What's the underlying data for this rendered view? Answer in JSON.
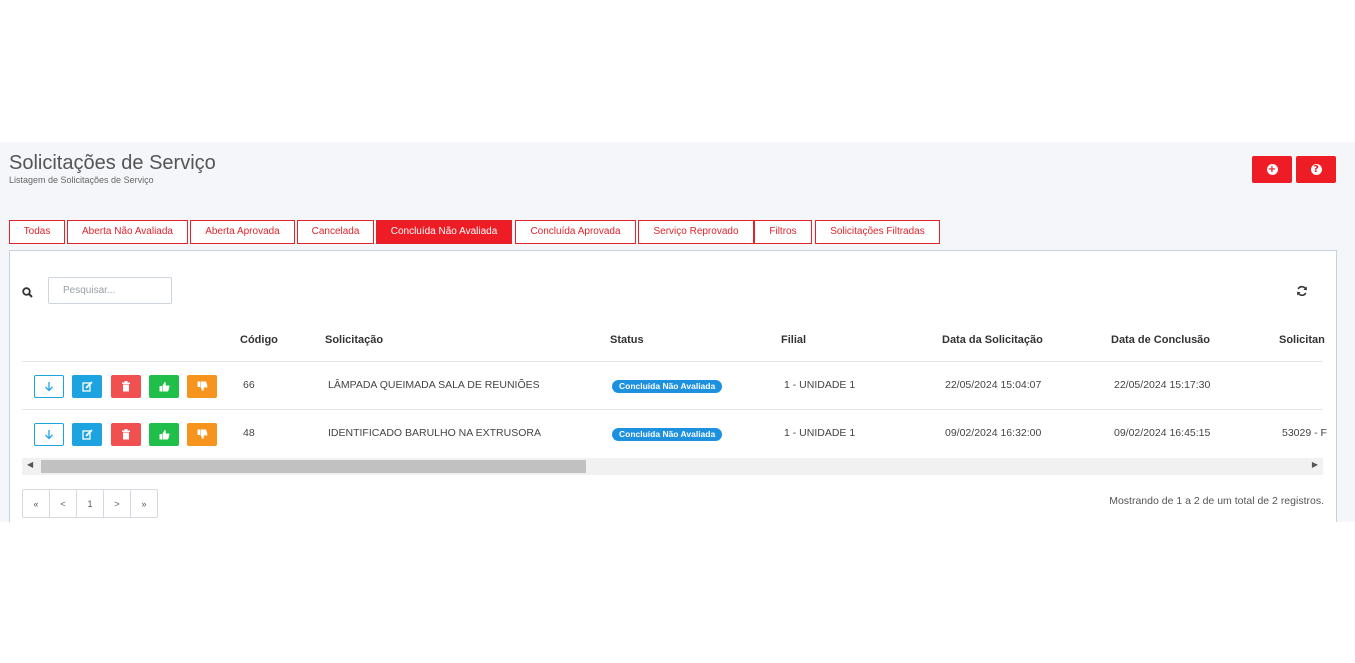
{
  "header": {
    "title": "Solicitações de Serviço",
    "subtitle": "Listagem de Solicitações de Serviço",
    "add_icon": "plus-circle-icon",
    "help_icon": "question-circle-icon",
    "accent_color": "#ee1c25"
  },
  "tabs": [
    {
      "label": "Todas",
      "active": false
    },
    {
      "label": "Aberta Não Avaliada",
      "active": false
    },
    {
      "label": "Aberta Aprovada",
      "active": false
    },
    {
      "label": "Cancelada",
      "active": false
    },
    {
      "label": "Concluída Não Avaliada",
      "active": true
    },
    {
      "label": "Concluída Aprovada",
      "active": false
    },
    {
      "label": "Serviço Reprovado",
      "active": false
    },
    {
      "label": "Filtros",
      "active": false
    },
    {
      "label": "Solicitações Filtradas",
      "active": false
    }
  ],
  "search": {
    "placeholder": "Pesquisar...",
    "value": ""
  },
  "table": {
    "columns": [
      "Código",
      "Solicitação",
      "Status",
      "Filial",
      "Data da Solicitação",
      "Data de Conclusão",
      "Solicitan"
    ],
    "rows": [
      {
        "codigo": "66",
        "solicitacao": "LÂMPADA QUEIMADA SALA DE REUNIÕES",
        "status": "Concluída Não Avaliada",
        "filial": "1 - UNIDADE 1",
        "data_solicitacao": "22/05/2024 15:04:07",
        "data_conclusao": "22/05/2024 15:17:30",
        "solicitante": ""
      },
      {
        "codigo": "48",
        "solicitacao": "IDENTIFICADO BARULHO NA EXTRUSORA",
        "status": "Concluída Não Avaliada",
        "filial": "1 - UNIDADE 1",
        "data_solicitacao": "09/02/2024 16:32:00",
        "data_conclusao": "09/02/2024 16:45:15",
        "solicitante": "53029 - F"
      }
    ],
    "status_color": "#1e90e0"
  },
  "pagination": {
    "first": "«",
    "prev": "<",
    "current": "1",
    "next": ">",
    "last": "»",
    "summary": "Mostrando de 1 a 2 de um total de 2 registros."
  }
}
